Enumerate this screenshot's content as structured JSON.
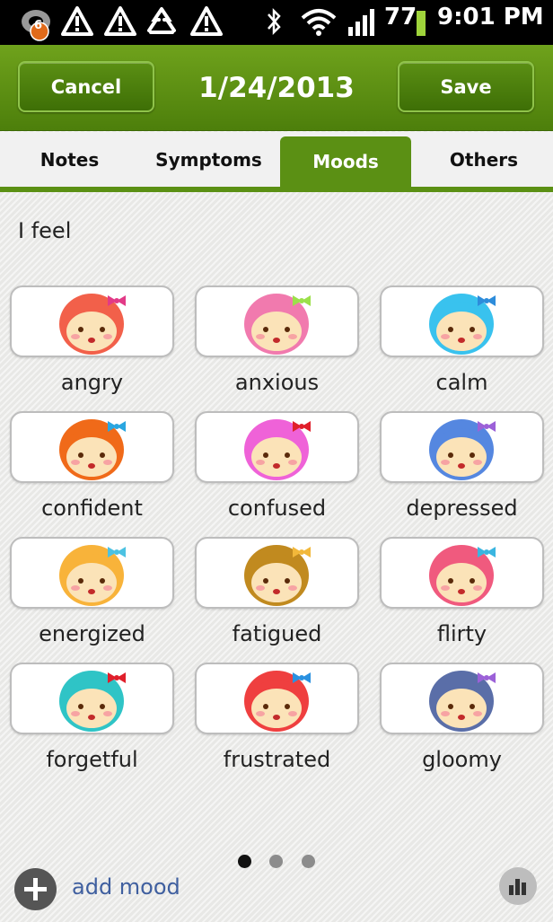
{
  "status_bar": {
    "notification_count": "6",
    "battery": "77",
    "time": "9:01 PM"
  },
  "action_bar": {
    "cancel_label": "Cancel",
    "title": "1/24/2013",
    "save_label": "Save"
  },
  "tabs": [
    {
      "label": "Notes",
      "active": false
    },
    {
      "label": "Symptoms",
      "active": false
    },
    {
      "label": "Moods",
      "active": true
    },
    {
      "label": "Others",
      "active": false
    }
  ],
  "content": {
    "prompt": "I feel",
    "moods": [
      {
        "label": "angry",
        "icon": "angry-face-icon",
        "color": "#f2604a",
        "bow": "#e23a87"
      },
      {
        "label": "anxious",
        "icon": "anxious-face-icon",
        "color": "#f17aae",
        "bow": "#9be04a"
      },
      {
        "label": "calm",
        "icon": "calm-face-icon",
        "color": "#39c2ee",
        "bow": "#2d8cdb"
      },
      {
        "label": "confident",
        "icon": "confident-face-icon",
        "color": "#f06a19",
        "bow": "#2aa6e0"
      },
      {
        "label": "confused",
        "icon": "confused-face-icon",
        "color": "#ef62d8",
        "bow": "#e01f2b"
      },
      {
        "label": "depressed",
        "icon": "depressed-face-icon",
        "color": "#5587e0",
        "bow": "#9c61d8"
      },
      {
        "label": "energized",
        "icon": "energized-face-icon",
        "color": "#f8b33a",
        "bow": "#4cc2e2"
      },
      {
        "label": "fatigued",
        "icon": "fatigued-face-icon",
        "color": "#c18a1f",
        "bow": "#f2b83a"
      },
      {
        "label": "flirty",
        "icon": "flirty-face-icon",
        "color": "#f05a7e",
        "bow": "#3ab5e0"
      },
      {
        "label": "forgetful",
        "icon": "forgetful-face-icon",
        "color": "#2fc4c6",
        "bow": "#e01f2b"
      },
      {
        "label": "frustrated",
        "icon": "frustrated-face-icon",
        "color": "#ef3f3f",
        "bow": "#2a91e0"
      },
      {
        "label": "gloomy",
        "icon": "gloomy-face-icon",
        "color": "#5a6ea8",
        "bow": "#9c61d8"
      }
    ]
  },
  "pager": {
    "pages": 3,
    "current": 1
  },
  "bottom_bar": {
    "add_label": "add mood"
  },
  "colors": {
    "accent": "#5b9014",
    "link": "#3f5f9f"
  }
}
